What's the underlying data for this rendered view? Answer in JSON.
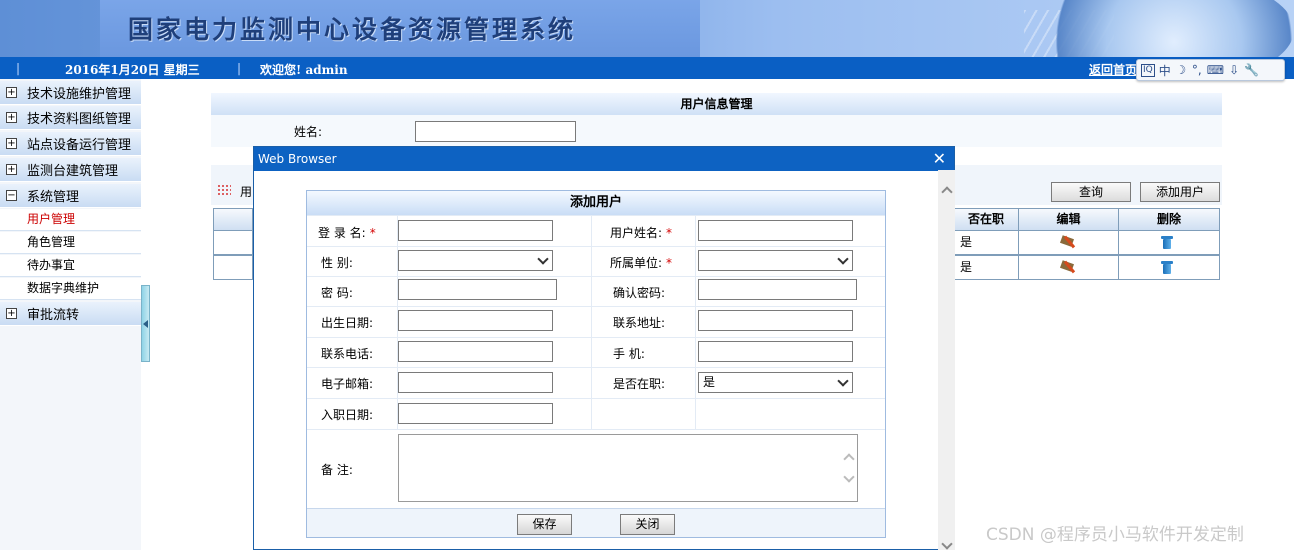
{
  "header": {
    "system_title": "国家电力监测中心设备资源管理系统",
    "date": "2016年1月20日  星期三",
    "welcome": "欢迎您!  admin",
    "home_link": "返回首页"
  },
  "ime_toolbar": [
    "中",
    "☽",
    "°,",
    "⌨",
    "⇩",
    "🔧"
  ],
  "sidebar": {
    "groups": [
      {
        "label": "技术设施维护管理",
        "toggle": "+"
      },
      {
        "label": "技术资料图纸管理",
        "toggle": "+"
      },
      {
        "label": "站点设备运行管理",
        "toggle": "+"
      },
      {
        "label": "监测台建筑管理",
        "toggle": "+"
      },
      {
        "label": "系统管理",
        "toggle": "−"
      },
      {
        "label": "审批流转",
        "toggle": "+"
      }
    ],
    "items": [
      {
        "label": "用户管理"
      },
      {
        "label": "角色管理"
      },
      {
        "label": "待办事宜"
      },
      {
        "label": "数据字典维护"
      }
    ]
  },
  "main": {
    "panel_title": "用户信息管理",
    "search_label": "姓名:",
    "search_value": "",
    "toolbar_label": "用",
    "query_button": "查询",
    "add_button": "添加用户",
    "columns": [
      "否在职",
      "编辑",
      "删除"
    ],
    "rows": [
      {
        "employed": "是"
      },
      {
        "employed": "是"
      }
    ]
  },
  "dialog": {
    "title": "Web Browser",
    "close_symbol": "✕",
    "form_title": "添加用户",
    "fields": {
      "login_name": {
        "label": "登 录 名:"
      },
      "user_name": {
        "label": "用户姓名:"
      },
      "gender": {
        "label": "性    别:"
      },
      "unit": {
        "label": "所属单位:"
      },
      "password": {
        "label": "密    码:"
      },
      "confirm_password": {
        "label": "确认密码:"
      },
      "birth_date": {
        "label": "出生日期:"
      },
      "address": {
        "label": "联系地址:"
      },
      "phone": {
        "label": "联系电话:"
      },
      "mobile": {
        "label": "手    机:"
      },
      "email": {
        "label": "电子邮箱:"
      },
      "employed": {
        "label": "是否在职:",
        "value": "是"
      },
      "hire_date": {
        "label": "入职日期:"
      },
      "remarks": {
        "label": "备    注:"
      }
    },
    "required_mark": "*",
    "save_button": "保存",
    "close_button": "关闭"
  },
  "watermark": "CSDN @程序员小马软件开发定制",
  "colors": {
    "title_bar": "#0d62c2",
    "info_bar": "#0a5fc4",
    "active_menu": "#cc0000",
    "required": "#d40000"
  }
}
